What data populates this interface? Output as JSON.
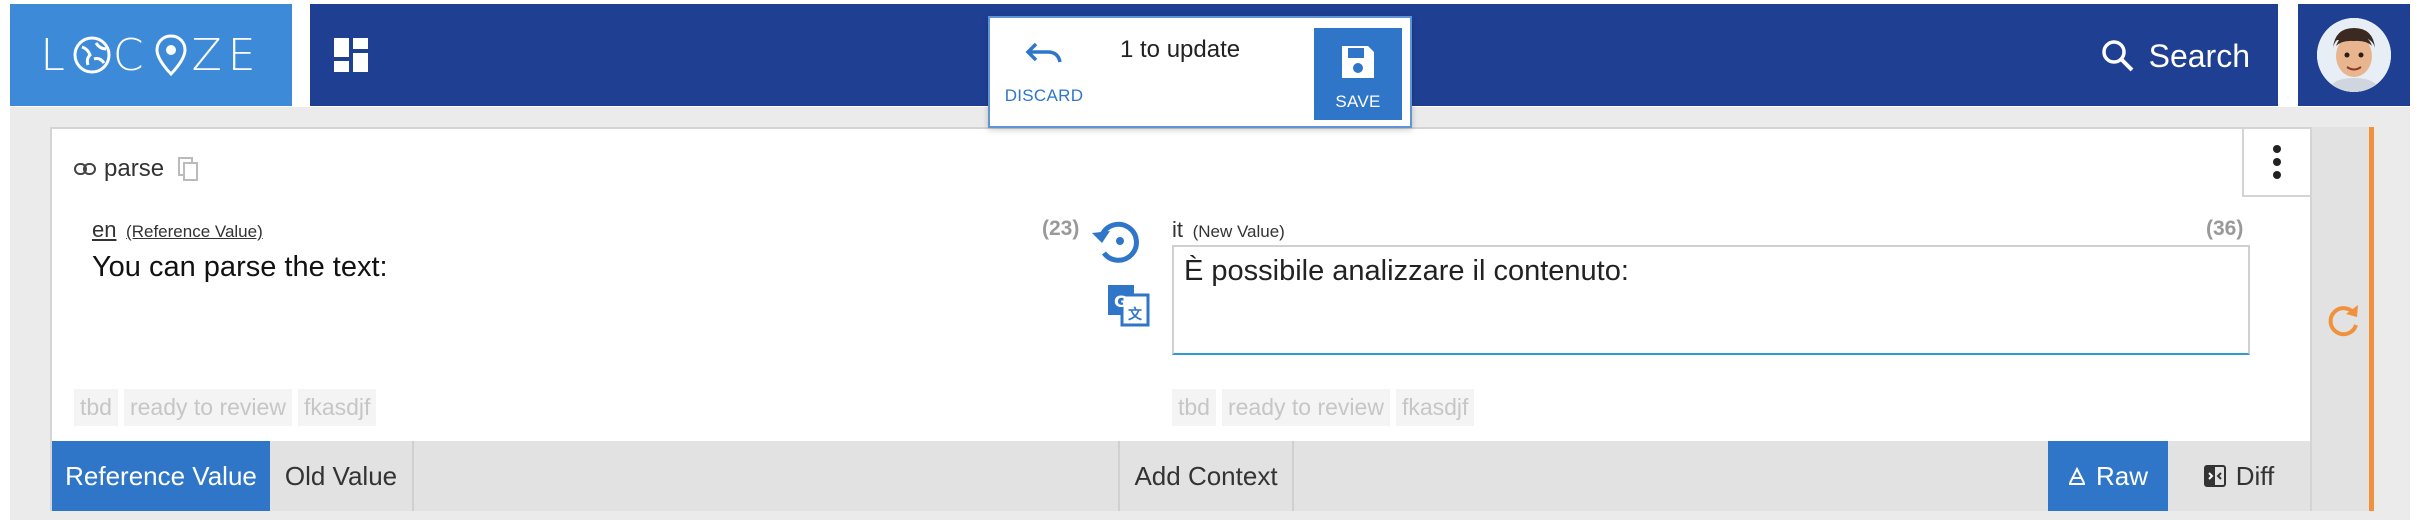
{
  "brand": {
    "logo_text": "LOCIZE",
    "accent": "#3c8ad8",
    "nav_color": "#1f3f93"
  },
  "header": {
    "search_label": "Search"
  },
  "update_popup": {
    "count_label": "1 to update",
    "discard_label": "DISCARD",
    "save_label": "SAVE"
  },
  "segment": {
    "key": "parse",
    "reference": {
      "lang": "en",
      "label": "(Reference Value)",
      "count": "(23)",
      "text": "You can parse the text:"
    },
    "target": {
      "lang": "it",
      "label": "(New Value)",
      "count": "(36)",
      "text": "È possibile analizzare il contenuto:"
    },
    "tags": [
      "tbd",
      "ready to review",
      "fkasdjf"
    ]
  },
  "bottom_tabs": {
    "reference_value": "Reference Value",
    "old_value": "Old Value",
    "add_context": "Add Context",
    "raw": "Raw",
    "diff": "Diff"
  },
  "colors": {
    "status_bar": "#f0913c",
    "primary": "#2f76c8"
  }
}
